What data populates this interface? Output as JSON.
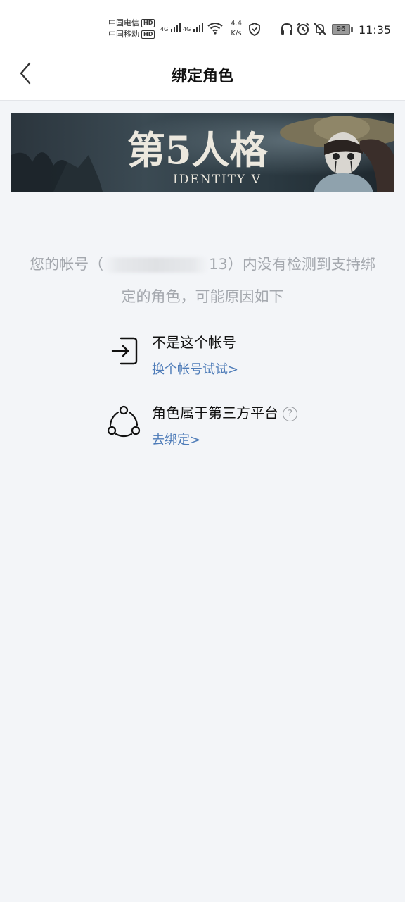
{
  "status_bar": {
    "carrier_1": "中国电信",
    "carrier_2": "中国移动",
    "hd_label": "HD",
    "signal_label_1": "4G",
    "signal_label_2": "4G",
    "net_speed_value": "4.4",
    "net_speed_unit": "K/s",
    "battery_level": "96",
    "time": "11:35"
  },
  "header": {
    "title": "绑定角色"
  },
  "banner": {
    "game_logo_text": "第5人格",
    "game_subtitle": "IDENTITY V"
  },
  "message": {
    "prefix": "您的帐号（",
    "account_tail": "13",
    "suffix": "）内没有检测到支持绑定的角色，可能原因如下"
  },
  "reasons": [
    {
      "title": "不是这个帐号",
      "link": "换个帐号试试>",
      "icon": "login-icon"
    },
    {
      "title": "角色属于第三方平台",
      "link": "去绑定>",
      "icon": "share-icon",
      "help": "?"
    }
  ],
  "colors": {
    "background": "#f3f5f8",
    "link": "#4d7bb8",
    "muted_text": "#a4a8ae"
  }
}
